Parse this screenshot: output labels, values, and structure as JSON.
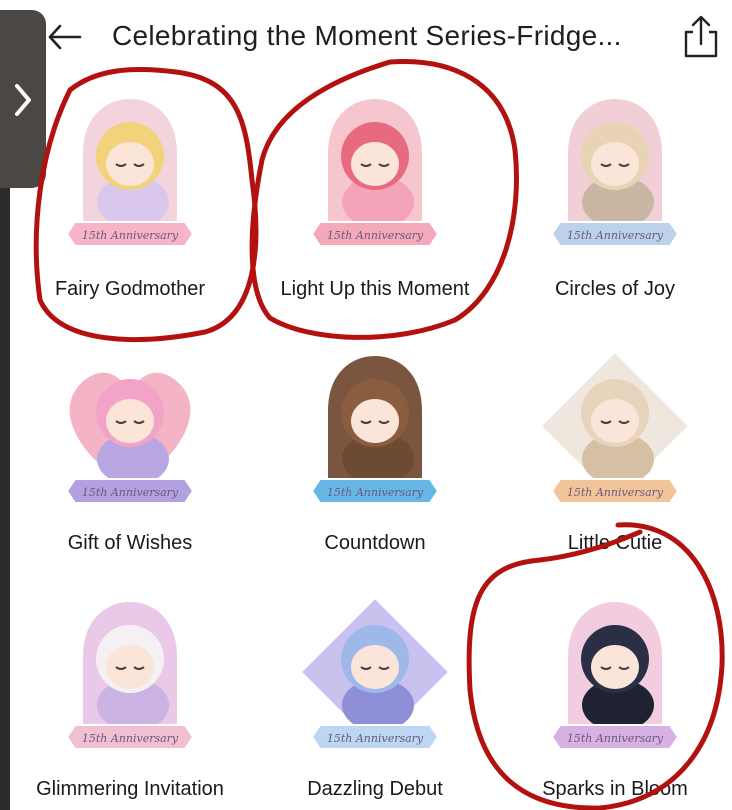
{
  "header": {
    "title": "Celebrating the Moment Series-Fridge..."
  },
  "icons": {
    "back": "back-arrow-icon",
    "share": "share-icon",
    "side_tab": "chevron-right-icon"
  },
  "items": [
    {
      "name": "Fairy Godmother",
      "ribbon": "15th Anniversary",
      "palette": {
        "body": "#d9c7ee",
        "hair": "#f2d27a",
        "frame": "#f3d4dc",
        "accent": "#f7b3c7"
      }
    },
    {
      "name": "Light Up this Moment",
      "ribbon": "15th Anniversary",
      "palette": {
        "body": "#f5a3b8",
        "hair": "#e86a7f",
        "frame": "#f6c6cf",
        "accent": "#f3a9b9"
      }
    },
    {
      "name": "Circles of Joy",
      "ribbon": "15th Anniversary",
      "palette": {
        "body": "#c9b6a3",
        "hair": "#e9d3b6",
        "frame": "#f0cfd6",
        "accent": "#bcd2ec"
      }
    },
    {
      "name": "Gift of Wishes",
      "ribbon": "15th Anniversary",
      "palette": {
        "body": "#b9a7e2",
        "hair": "#f2a3c7",
        "frame": "#f4b4c6",
        "accent": "#b3a0e1"
      }
    },
    {
      "name": "Countdown",
      "ribbon": "15th Anniversary",
      "palette": {
        "body": "#6d4a34",
        "hair": "#8b5c3f",
        "frame": "#7a5540",
        "accent": "#66b7e6"
      }
    },
    {
      "name": "Little Cutie",
      "ribbon": "15th Anniversary",
      "palette": {
        "body": "#d7bfa3",
        "hair": "#e6d4bd",
        "frame": "#efe7dd",
        "accent": "#f1c49a"
      }
    },
    {
      "name": "Glimmering Invitation",
      "ribbon": "15th Anniversary",
      "palette": {
        "body": "#cbb4e4",
        "hair": "#f5f0f2",
        "frame": "#e9c8e8",
        "accent": "#f0bfd1"
      }
    },
    {
      "name": "Dazzling Debut",
      "ribbon": "15th Anniversary",
      "palette": {
        "body": "#8e8fd8",
        "hair": "#9fb8ea",
        "frame": "#c9c1ee",
        "accent": "#bcd6f3"
      }
    },
    {
      "name": "Sparks in Bloom",
      "ribbon": "15th Anniversary",
      "palette": {
        "body": "#1f2233",
        "hair": "#2b2f45",
        "frame": "#f2cde0",
        "accent": "#d7b1e4"
      }
    }
  ],
  "annotation_color": "#b3110f"
}
